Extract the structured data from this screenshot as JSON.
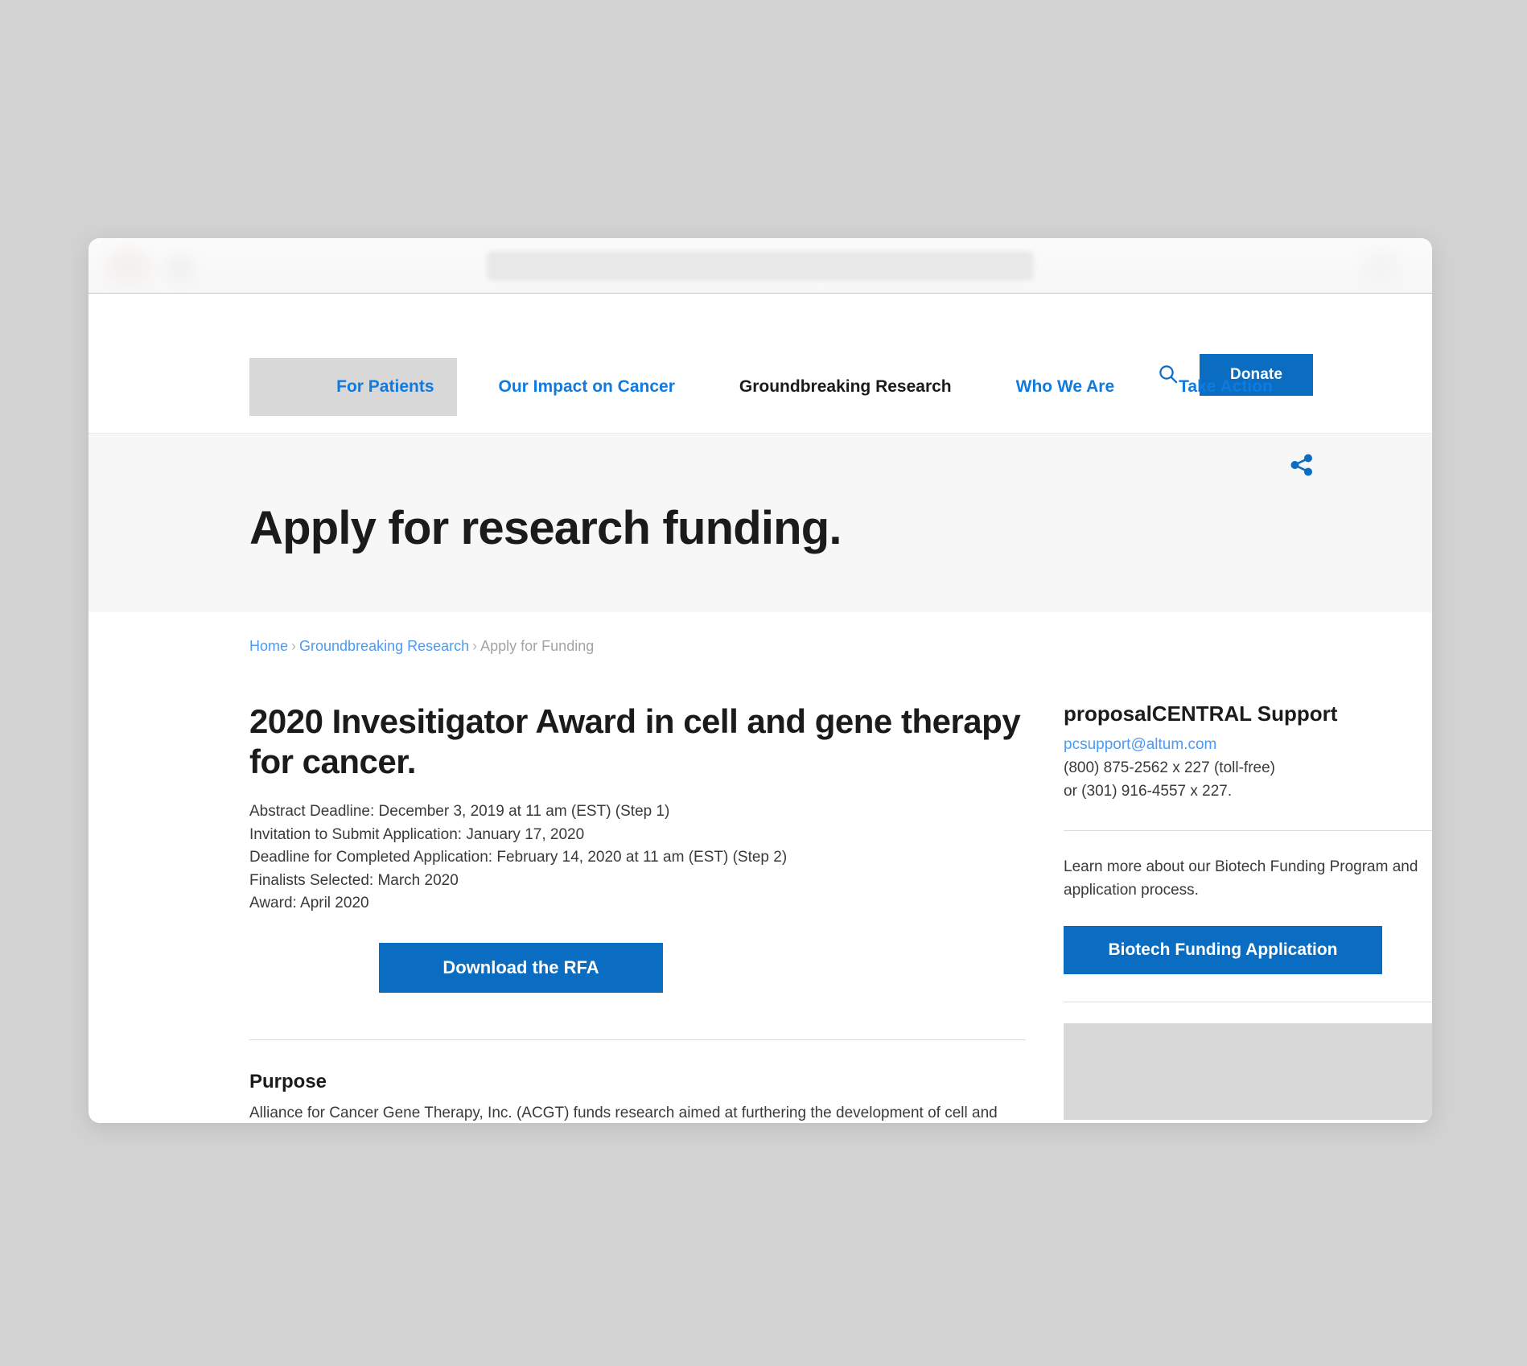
{
  "browser": {
    "url_bar_placeholder": ""
  },
  "header": {
    "logo_alt": "site-logo",
    "search_icon": "search-icon",
    "donate_label": "Donate",
    "nav": [
      {
        "label": "For Patients",
        "active": false
      },
      {
        "label": "Our Impact on Cancer",
        "active": false
      },
      {
        "label": "Groundbreaking Research",
        "active": true
      },
      {
        "label": "Who We Are",
        "active": false
      },
      {
        "label": "Take Action",
        "active": false
      }
    ]
  },
  "hero": {
    "title": "Apply for research funding.",
    "share_icon": "share-icon"
  },
  "breadcrumb": {
    "items": [
      {
        "label": "Home",
        "link": true
      },
      {
        "label": "Groundbreaking Research",
        "link": true
      },
      {
        "label": "Apply for Funding",
        "link": false
      }
    ],
    "separator": "›"
  },
  "main": {
    "award_title": "2020 Invesitigator Award in cell and gene therapy for cancer.",
    "deadlines": [
      "Abstract Deadline: December 3, 2019 at 11 am (EST) (Step 1)",
      "Invitation to Submit Application: January 17, 2020",
      "Deadline for Completed Application: February 14, 2020 at 11 am (EST) (Step 2)",
      "Finalists Selected: March 2020",
      "Award: April 2020"
    ],
    "download_label": "Download the RFA",
    "purpose_heading": "Purpose",
    "purpose_body": "Alliance for Cancer Gene Therapy, Inc. (ACGT) funds research aimed at furthering the development of cell and gene therapy approaches to the treatment of cancer."
  },
  "sidebar": {
    "support_heading": "proposalCENTRAL Support",
    "support_email": "pcsupport@altum.com",
    "phone_primary": "(800) 875-2562 x 227 (toll-free)",
    "phone_secondary": "or (301) 916-4557 x 227.",
    "learn_more_text": "Learn more about our Biotech Funding Program and application process.",
    "biotech_button_label": "Biotech Funding Application"
  },
  "colors": {
    "accent_blue": "#0a6dc2",
    "link_blue": "#4b9af3",
    "nav_blue": "#0f7ae0",
    "page_background": "#d2d2d2",
    "hero_background": "#f7f7f7",
    "placeholder_gray": "#d8d8d8",
    "text_dark": "#1b1b1b",
    "text_body": "#3a3a3a",
    "divider": "#dcdcdc"
  }
}
